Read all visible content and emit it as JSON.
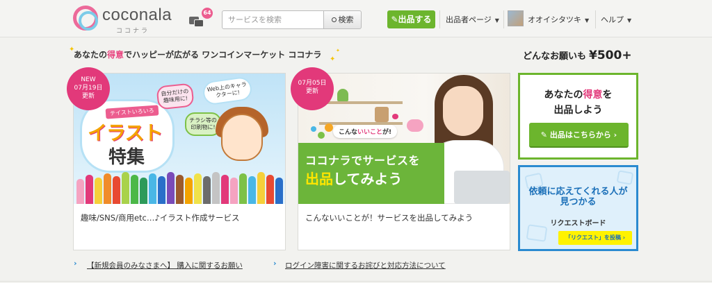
{
  "header": {
    "logo_text": "coconala",
    "logo_sub": "ココナラ",
    "message_badge": "64",
    "search_placeholder": "サービスを検索",
    "search_button": "検索",
    "sell_button": "出品する",
    "nav_seller_page": "出品者ページ",
    "nav_user": "オオイシタツキ",
    "nav_help": "ヘルプ"
  },
  "tagline": {
    "part1": "あなたの",
    "emph": "得意",
    "part2": "でハッピーが広がる ワンコインマーケット ココナラ"
  },
  "price": {
    "text": "どんなお願いも",
    "amount": "¥500+"
  },
  "cards": [
    {
      "ribbon_new": "NEW",
      "ribbon_date": "07月19日",
      "ribbon_updated": "更新",
      "tag": "テイストいろいろ",
      "title1": "イラスト",
      "title2": "特集",
      "sticky1": "自分だけの趣味用に!",
      "sticky2": "Web上のキャラクターに!",
      "sticky3": "チラシ等の印刷物に!",
      "caption": "趣味/SNS/商用etc…♪イラスト作成サービス"
    },
    {
      "ribbon_date": "07月05日",
      "ribbon_updated": "更新",
      "bubble_pre": "こんな",
      "bubble_emph": "いいこと",
      "bubble_post": "が!",
      "line1": "ココナラでサービスを",
      "line2_emph": "出品",
      "line2_rest": "してみよう",
      "caption": "こんないいことが！サービスを出品してみよう"
    }
  ],
  "sell_box": {
    "title_pre": "あなたの",
    "title_emph": "得意",
    "title_post": "を",
    "title_line2": "出品しよう",
    "button": "出品はこちらから"
  },
  "request_box": {
    "title_line1": "依頼に応えてくれる人が",
    "title_line2": "見つかる",
    "subtitle": "リクエストボード",
    "button": "「リクエスト」を投稿"
  },
  "news": [
    {
      "text": "【新規会員のみなさまへ】 購入に関するお願い"
    },
    {
      "text": "ログイン障害に関するお詫びと対応方法について"
    }
  ],
  "colors": {
    "brand_green": "#6cb52d",
    "brand_pink": "#e2397a",
    "brand_blue": "#2a8ad0"
  }
}
